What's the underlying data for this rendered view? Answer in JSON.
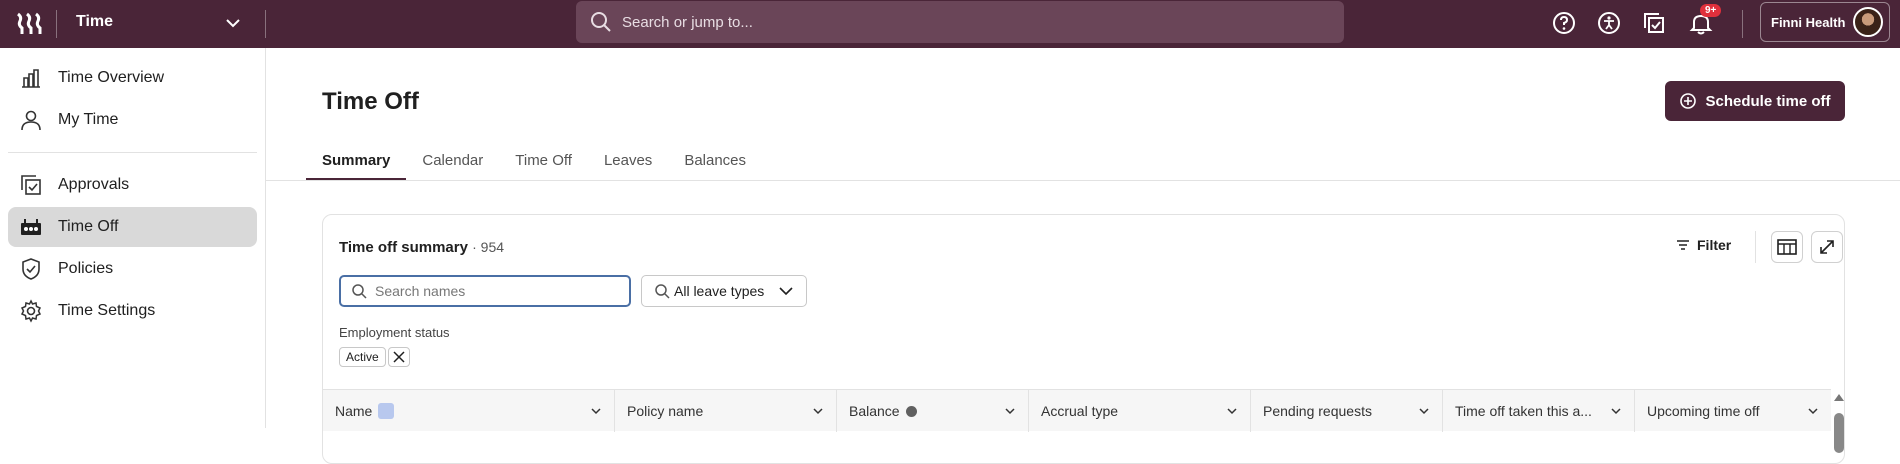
{
  "topbar": {
    "app_name": "Time",
    "search_placeholder": "Search or jump to...",
    "notifications_badge": "9+",
    "account_name": "Finni Health"
  },
  "sidebar": {
    "items": [
      {
        "label": "Time Overview",
        "icon": "bar-chart-icon"
      },
      {
        "label": "My Time",
        "icon": "person-icon"
      },
      {
        "label": "Approvals",
        "icon": "approvals-icon"
      },
      {
        "label": "Time Off",
        "icon": "time-off-icon",
        "active": true
      },
      {
        "label": "Policies",
        "icon": "shield-check-icon"
      },
      {
        "label": "Time Settings",
        "icon": "gear-icon"
      }
    ]
  },
  "main": {
    "title": "Time Off",
    "schedule_button": "Schedule time off",
    "tabs": [
      {
        "label": "Summary",
        "active": true
      },
      {
        "label": "Calendar"
      },
      {
        "label": "Time Off"
      },
      {
        "label": "Leaves"
      },
      {
        "label": "Balances"
      }
    ]
  },
  "card": {
    "title": "Time off summary",
    "count": "· 954",
    "filter_label": "Filter",
    "name_search_placeholder": "Search names",
    "leave_types_label": "All leave types",
    "employment_status_label": "Employment status",
    "chip_label": "Active",
    "columns": [
      {
        "label": "Name"
      },
      {
        "label": "Policy name"
      },
      {
        "label": "Balance"
      },
      {
        "label": "Accrual type"
      },
      {
        "label": "Pending requests"
      },
      {
        "label": "Time off taken this a..."
      },
      {
        "label": "Upcoming time off"
      }
    ]
  },
  "colors": {
    "brand": "#4a2538",
    "active_nav": "#d9d9d9",
    "focus_border": "#4a6fa5",
    "badge": "#e0303c"
  }
}
